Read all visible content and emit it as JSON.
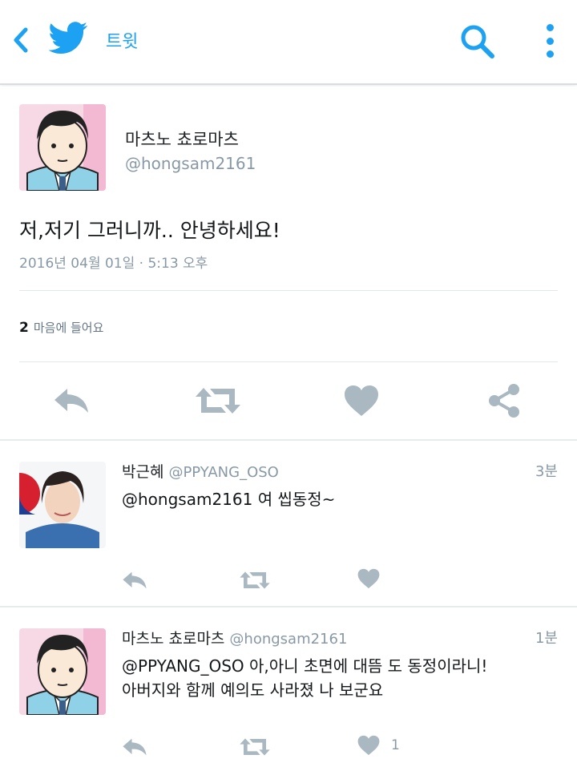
{
  "header": {
    "title": "트윗",
    "accent_color": "#1da1f2",
    "icons": [
      "back-chevron-icon",
      "twitter-bird-icon",
      "search-icon",
      "more-vertical-icon"
    ]
  },
  "tweet": {
    "author_name": "마츠노 쵸로마츠",
    "author_handle": "@hongsam2161",
    "text": "저,저기 그러니까.. 안녕하세요!",
    "timestamp": "2016년 04월 01일 · 5:13 오후",
    "likes_count": "2",
    "likes_label": "마음에 들어요",
    "actions": [
      "reply-icon",
      "retweet-icon",
      "heart-icon",
      "share-icon"
    ]
  },
  "replies": [
    {
      "author_name": "박근혜",
      "author_handle": "@PPYANG_OSO",
      "time": "3분",
      "text": "@hongsam2161 여 씹동정~",
      "like_count": ""
    },
    {
      "author_name": "마츠노 쵸로마츠",
      "author_handle": "@hongsam2161",
      "time": "1분",
      "text_line1": "@PPYANG_OSO 아,아니 초면에 대뜸 도 동정이라니!",
      "text_line2": "아버지와 함께 예의도 사라졌 나 보군요",
      "like_count": "1"
    }
  ]
}
